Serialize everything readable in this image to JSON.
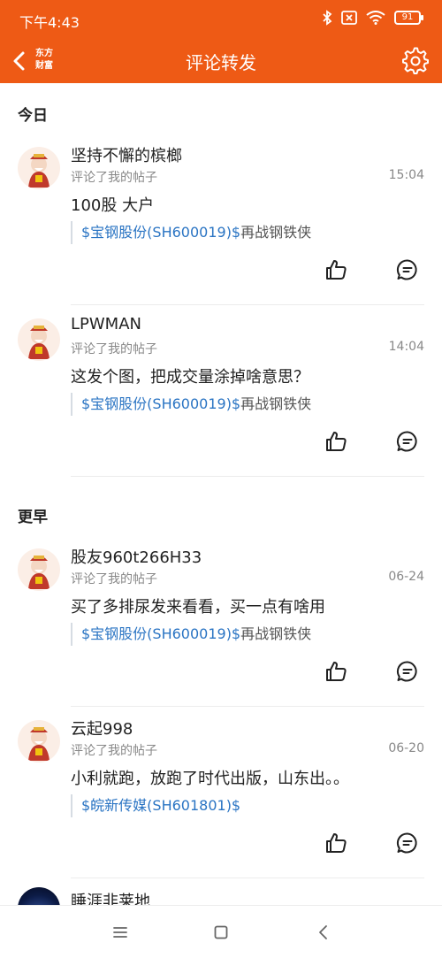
{
  "status_bar": {
    "time": "下午4:43",
    "battery": "91"
  },
  "header": {
    "brand": "东方财富",
    "title": "评论转发"
  },
  "sections": [
    {
      "title": "今日",
      "items": [
        {
          "name": "坚持不懈的槟榔",
          "action": "评论了我的帖子",
          "time": "15:04",
          "body": "100股 大户",
          "quote_link": "$宝钢股份(SH600019)$",
          "quote_text": "再战钢铁侠"
        },
        {
          "name": "LPWMAN",
          "action": "评论了我的帖子",
          "time": "14:04",
          "body": "这发个图，把成交量涂掉啥意思？",
          "quote_link": "$宝钢股份(SH600019)$",
          "quote_text": "再战钢铁侠"
        }
      ]
    },
    {
      "title": "更早",
      "items": [
        {
          "name": "股友960t266H33",
          "action": "评论了我的帖子",
          "time": "06-24",
          "body": "买了多排尿发来看看，买一点有啥用",
          "quote_link": "$宝钢股份(SH600019)$",
          "quote_text": "再战钢铁侠"
        },
        {
          "name": "云起998",
          "action": "评论了我的帖子",
          "time": "06-20",
          "body": "小利就跑，放跑了时代出版，山东出。。",
          "quote_link": "$皖新传媒(SH601801)$",
          "quote_text": ""
        }
      ]
    }
  ],
  "partial_item": {
    "name": "睡涯非莱地"
  },
  "colors": {
    "accent": "#ee5a15",
    "link": "#2a74c3"
  }
}
